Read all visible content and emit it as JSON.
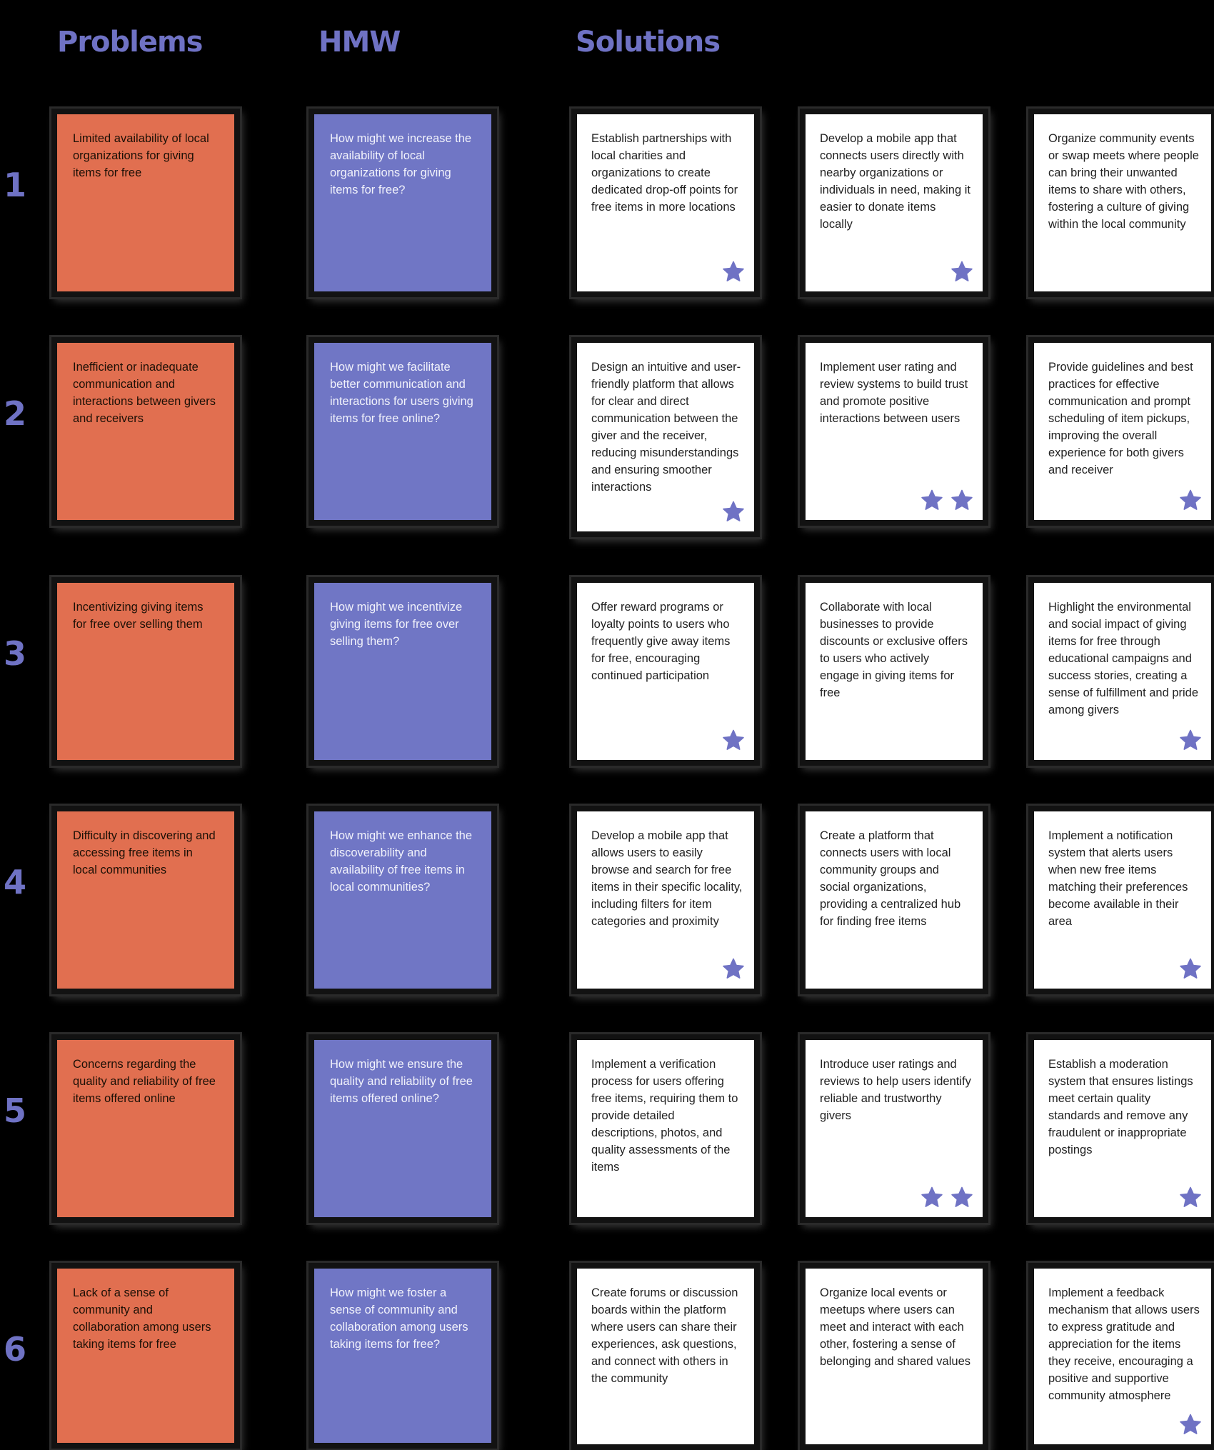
{
  "headers": {
    "problems": "Problems",
    "hmw": "HMW",
    "solutions": "Solutions"
  },
  "colors": {
    "problem_note": "#e16f50",
    "hmw_note": "#7076c5",
    "solution_note": "#ffffff",
    "accent": "#6f72c4",
    "background": "#000000"
  },
  "rows": [
    {
      "number": "1",
      "problem": "Limited availability of local organizations for giving items for free",
      "hmw": "How might we increase the availability of local organizations for giving items for free?",
      "solutions": [
        {
          "text": "Establish partnerships with local charities and organizations to create dedicated drop-off points for free items in more locations",
          "votes": 1
        },
        {
          "text": "Develop a mobile app that connects users directly with nearby organizations or individuals in need, making it easier to donate items locally",
          "votes": 1
        },
        {
          "text": "Organize community events or swap meets where people can bring their unwanted items to share with others, fostering a culture of giving within the local community",
          "votes": 0
        }
      ]
    },
    {
      "number": "2",
      "problem": "Inefficient or inadequate communication and interactions between givers and receivers",
      "hmw": "How might we facilitate better communication and interactions for users giving items for free online?",
      "solutions": [
        {
          "text": "Design an intuitive and user-friendly platform that allows for clear and direct communication between the giver and the receiver, reducing misunderstandings and ensuring smoother interactions",
          "votes": 1
        },
        {
          "text": "Implement user rating and review systems to build trust and promote positive interactions between users",
          "votes": 2
        },
        {
          "text": "Provide guidelines and best practices for effective communication and prompt scheduling of item pickups, improving the overall experience for both givers and receiver",
          "votes": 1
        }
      ]
    },
    {
      "number": "3",
      "problem": "Incentivizing giving items for free over selling them",
      "hmw": "How might we incentivize giving items for free over selling them?",
      "solutions": [
        {
          "text": "Offer reward programs or loyalty points to users who frequently give away items for free, encouraging continued participation",
          "votes": 1
        },
        {
          "text": "Collaborate with local businesses to provide discounts or exclusive offers to users who actively engage in giving items for free",
          "votes": 0
        },
        {
          "text": "Highlight the environmental and social impact of giving items for free through educational campaigns and success stories, creating a sense of fulfillment and pride among givers",
          "votes": 1
        }
      ]
    },
    {
      "number": "4",
      "problem": "Difficulty in discovering and accessing free items in local communities",
      "hmw": "How might we enhance the discoverability and availability of free items in local communities?",
      "solutions": [
        {
          "text": "Develop a mobile app that allows users to easily browse and search for free items in their specific locality, including filters for item categories and proximity",
          "votes": 1
        },
        {
          "text": "Create a platform that connects users with local community groups and social organizations, providing a centralized hub for finding free items",
          "votes": 0
        },
        {
          "text": "Implement a notification system that alerts users when new free items matching their preferences become available in their area",
          "votes": 1
        }
      ]
    },
    {
      "number": "5",
      "problem": "Concerns regarding the quality and reliability of free items offered online",
      "hmw": "How might we ensure the quality and reliability of free items offered online?",
      "solutions": [
        {
          "text": "Implement a verification process for users offering free items, requiring them to provide detailed descriptions, photos, and quality assessments of the items",
          "votes": 0
        },
        {
          "text": "Introduce user ratings and reviews to help users identify reliable and trustworthy givers",
          "votes": 2
        },
        {
          "text": "Establish a moderation system that ensures listings meet certain quality standards and remove any fraudulent or inappropriate postings",
          "votes": 1
        }
      ]
    },
    {
      "number": "6",
      "problem": "Lack of a sense of community and collaboration among users taking items for free",
      "hmw": "How might we foster a sense of community and collaboration among users taking items for free?",
      "solutions": [
        {
          "text": "Create forums or discussion boards within the platform where users can share their experiences, ask questions, and connect with others in the community",
          "votes": 0
        },
        {
          "text": "Organize local events or meetups where users can meet and interact with each other, fostering a sense of belonging and shared values",
          "votes": 0
        },
        {
          "text": "Implement a feedback mechanism that allows users to express gratitude and appreciation for the items they receive, encouraging a positive and supportive community atmosphere",
          "votes": 1
        }
      ]
    }
  ]
}
